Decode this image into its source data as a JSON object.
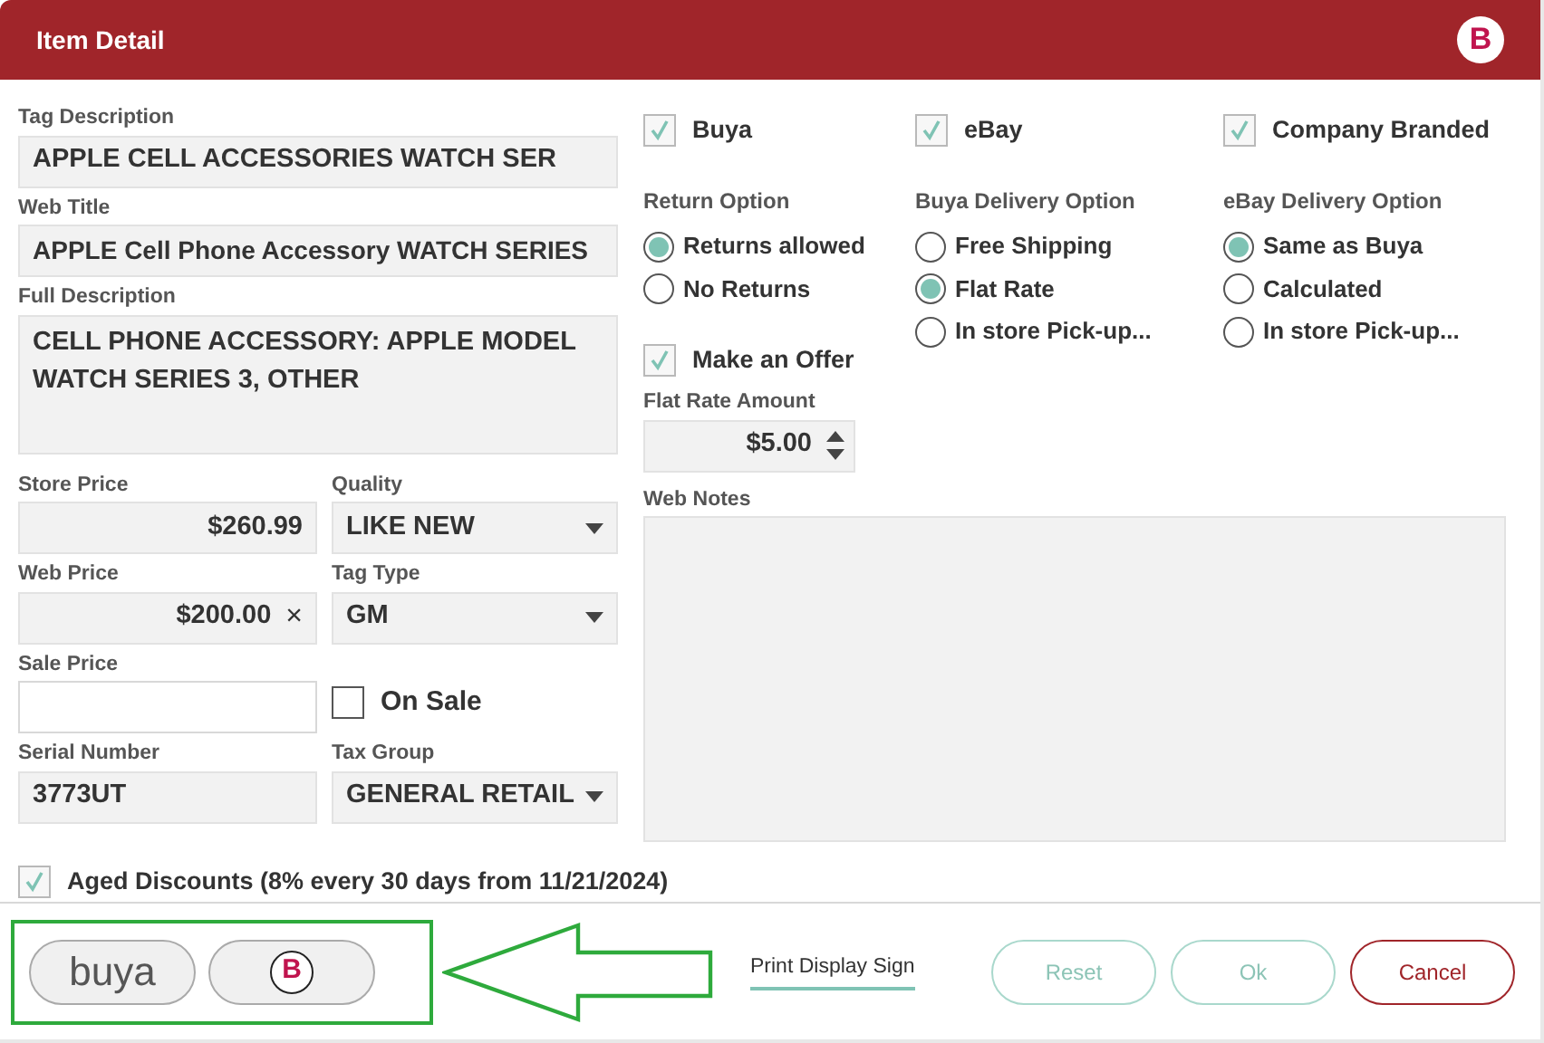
{
  "window": {
    "title": "Item Detail",
    "logo_mark": "B"
  },
  "tag_description": {
    "label": "Tag Description",
    "value": "APPLE CELL ACCESSORIES WATCH SER"
  },
  "web_title": {
    "label": "Web Title",
    "value": "APPLE Cell Phone Accessory WATCH SERIES"
  },
  "full_description": {
    "label": "Full Description",
    "value": "CELL PHONE ACCESSORY: APPLE MODEL WATCH SERIES 3, OTHER"
  },
  "store_price": {
    "label": "Store Price",
    "value": "$260.99"
  },
  "quality": {
    "label": "Quality",
    "value": "LIKE NEW"
  },
  "web_price": {
    "label": "Web Price",
    "value": "$200.00",
    "clear": "×"
  },
  "tag_type": {
    "label": "Tag Type",
    "value": "GM"
  },
  "sale_price": {
    "label": "Sale Price"
  },
  "on_sale": {
    "label": "On Sale",
    "checked": false
  },
  "serial_number": {
    "label": "Serial Number",
    "value": "3773UT"
  },
  "tax_group": {
    "label": "Tax Group",
    "value": "GENERAL RETAIL"
  },
  "aged_discounts": {
    "label": "Aged Discounts (8% every 30 days from 11/21/2024)",
    "checked": true
  },
  "channels": [
    {
      "label": "Buya",
      "checked": true
    },
    {
      "label": "eBay",
      "checked": true
    },
    {
      "label": "Company Branded",
      "checked": true
    }
  ],
  "option_groups": [
    {
      "label": "Return Option",
      "options": [
        {
          "label": "Returns allowed",
          "selected": true
        },
        {
          "label": "No Returns",
          "selected": false
        }
      ]
    },
    {
      "label": "Buya Delivery Option",
      "options": [
        {
          "label": "Free Shipping",
          "selected": false
        },
        {
          "label": "Flat Rate",
          "selected": true
        },
        {
          "label": "In store Pick-up...",
          "selected": false
        }
      ]
    },
    {
      "label": "eBay Delivery Option",
      "options": [
        {
          "label": "Same as Buya",
          "selected": true
        },
        {
          "label": "Calculated",
          "selected": false
        },
        {
          "label": "In store Pick-up...",
          "selected": false
        }
      ]
    }
  ],
  "make_an_offer": {
    "label": "Make an Offer",
    "checked": true
  },
  "flat_rate_amount": {
    "label": "Flat Rate Amount",
    "value": "$5.00"
  },
  "web_notes": {
    "label": "Web Notes"
  },
  "footer": {
    "brand_buttons": [
      {
        "text": "buya"
      },
      {
        "text": "B"
      }
    ],
    "print_link": "Print Display Sign",
    "buttons": [
      {
        "label": "Reset",
        "kind": "secondary"
      },
      {
        "label": "Ok",
        "kind": "secondary"
      },
      {
        "label": "Cancel",
        "kind": "danger"
      }
    ]
  }
}
